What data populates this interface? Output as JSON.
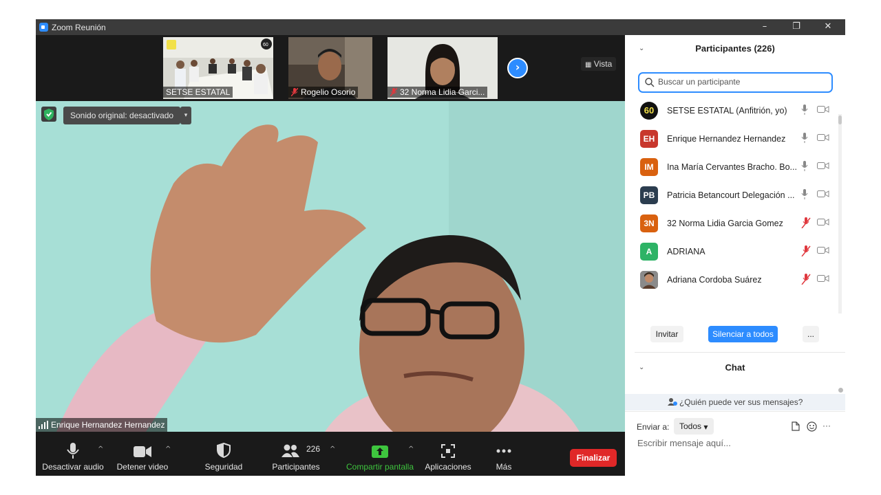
{
  "window": {
    "title": "Zoom Reunión",
    "minimize": "–",
    "restore": "❐",
    "close": "✕"
  },
  "strip": {
    "thumbnails": [
      {
        "name": "SETSE ESTATAL",
        "muted": false
      },
      {
        "name": "Rogelio Osorio",
        "muted": true
      },
      {
        "name": "32 Norma Lidia Garci...",
        "muted": true
      }
    ],
    "next": "›",
    "view_label": "Vista"
  },
  "main": {
    "sound_label": "Sonido original: desactivado",
    "sound_caret": "▾",
    "speaker": "Enrique Hernandez Hernandez"
  },
  "toolbar": {
    "audio": "Desactivar audio",
    "video": "Detener video",
    "security": "Seguridad",
    "participants": "Participantes",
    "participants_count": "226",
    "share": "Compartir pantalla",
    "apps": "Aplicaciones",
    "more": "Más",
    "end": "Finalizar",
    "caret": "^",
    "colors": {
      "share": "#3ec53e",
      "end": "#e02828"
    }
  },
  "participants_panel": {
    "title": "Participantes (226)",
    "chevron": "⌄",
    "search_placeholder": "Buscar un participante",
    "participants": [
      {
        "initials": "60",
        "name": "SETSE ESTATAL (Anfitrión, yo)",
        "color": "#111111",
        "muted": false
      },
      {
        "initials": "EH",
        "name": "Enrique Hernandez Hernandez",
        "color": "#c8372d",
        "muted": false
      },
      {
        "initials": "IM",
        "name": "Ina María Cervantes Bracho. Bo...",
        "color": "#d9610f",
        "muted": false
      },
      {
        "initials": "PB",
        "name": "Patricia Betancourt Delegación ...",
        "color": "#2b3d4f",
        "muted": false
      },
      {
        "initials": "3N",
        "name": "32 Norma Lidia Garcia Gomez",
        "color": "#d9610f",
        "muted": true
      },
      {
        "initials": "A",
        "name": "ADRIANA",
        "color": "#2eb366",
        "muted": true
      },
      {
        "initials": "",
        "name": "Adriana Cordoba Suárez",
        "color": "#9a7b63",
        "muted": true
      }
    ],
    "invite": "Invitar",
    "mute_all": "Silenciar a todos",
    "more": "..."
  },
  "chat": {
    "title": "Chat",
    "chevron": "⌄",
    "who_can_see": "¿Quién puede ver sus mensajes?",
    "send_to_label": "Enviar a:",
    "send_to_value": "Todos",
    "more": "···",
    "input_placeholder": "Escribir mensaje aquí..."
  }
}
